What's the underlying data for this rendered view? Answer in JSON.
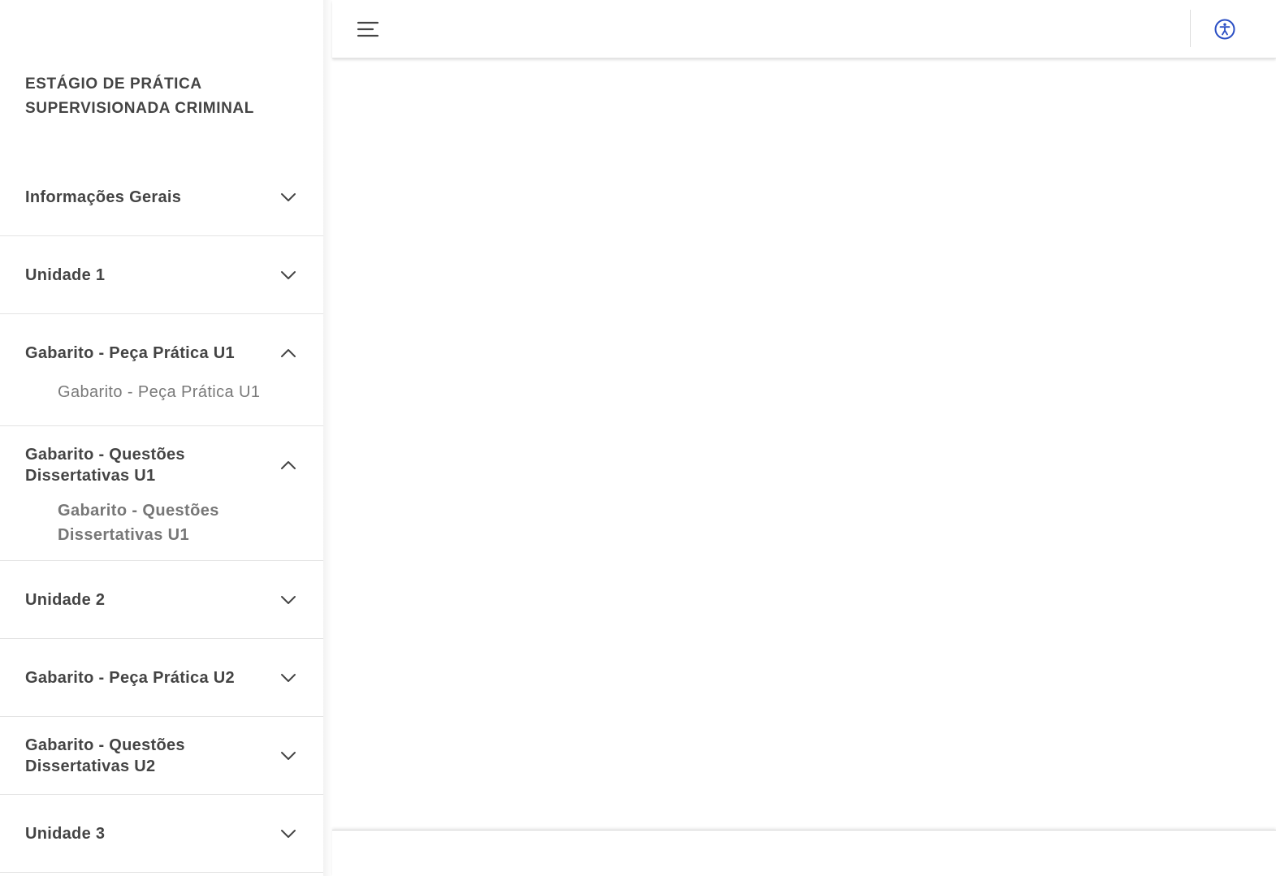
{
  "course": {
    "title": "ESTÁGIO DE PRÁTICA SUPERVISIONADA CRIMINAL"
  },
  "icons": {
    "menu": "menu-icon",
    "accessibility": "accessibility-icon",
    "chevron_down": "chevron-down-icon",
    "chevron_up": "chevron-up-icon"
  },
  "colors": {
    "accent": "#2b4fc4",
    "text": "#444444",
    "subtext": "#7a7a7a",
    "divider": "#e3e3e3"
  },
  "nav": {
    "sections": [
      {
        "label": "Informações Gerais",
        "expanded": false,
        "items": []
      },
      {
        "label": "Unidade 1",
        "expanded": false,
        "items": []
      },
      {
        "label": "Gabarito - Peça Prática U1",
        "expanded": true,
        "items": [
          {
            "label": "Gabarito - Peça Prática U1",
            "active": false
          }
        ]
      },
      {
        "label": "Gabarito - Questões Dissertativas U1",
        "expanded": true,
        "items": [
          {
            "label": "Gabarito - Questões Dissertativas U1",
            "active": true
          }
        ]
      },
      {
        "label": "Unidade 2",
        "expanded": false,
        "items": []
      },
      {
        "label": "Gabarito - Peça Prática U2",
        "expanded": false,
        "items": []
      },
      {
        "label": "Gabarito - Questões Dissertativas U2",
        "expanded": false,
        "items": []
      },
      {
        "label": "Unidade 3",
        "expanded": false,
        "items": []
      }
    ]
  }
}
